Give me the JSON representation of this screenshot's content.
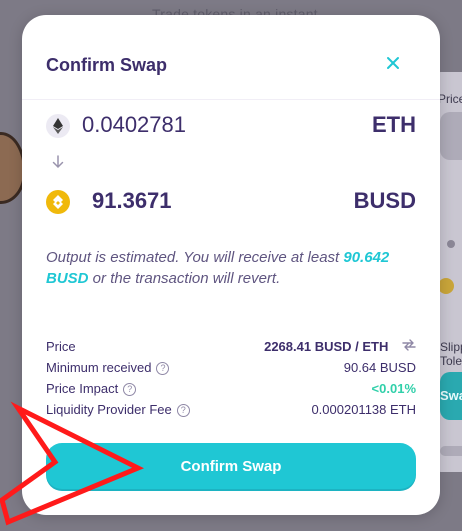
{
  "background": {
    "top_text": "Trade tokens in an instant",
    "price_label": "Price",
    "tab_label": "Slippage Tolerance",
    "button_label": "Swap"
  },
  "modal": {
    "title": "Confirm Swap",
    "close_icon": "close-icon",
    "input": {
      "amount": "0.0402781",
      "symbol": "ETH",
      "icon": "eth-icon"
    },
    "output": {
      "amount": "91.3671",
      "symbol": "BUSD",
      "icon": "busd-icon"
    },
    "estimate": {
      "prefix": "Output is estimated. You will receive at least ",
      "amount": "90.642 BUSD",
      "suffix": " or the transaction will revert."
    },
    "details": {
      "price_label": "Price",
      "price_value": "2268.41 BUSD / ETH",
      "minimum_label": "Minimum received",
      "minimum_value": "90.64 BUSD",
      "impact_label": "Price Impact",
      "impact_value": "<0.01%",
      "fee_label": "Liquidity Provider Fee",
      "fee_value": "0.000201138 ETH"
    },
    "confirm_button": "Confirm Swap"
  },
  "colors": {
    "accent": "#1fc7d4",
    "text_primary": "#3d2e6b",
    "success": "#31d0aa",
    "annotation_arrow": "#ff1a1a"
  }
}
